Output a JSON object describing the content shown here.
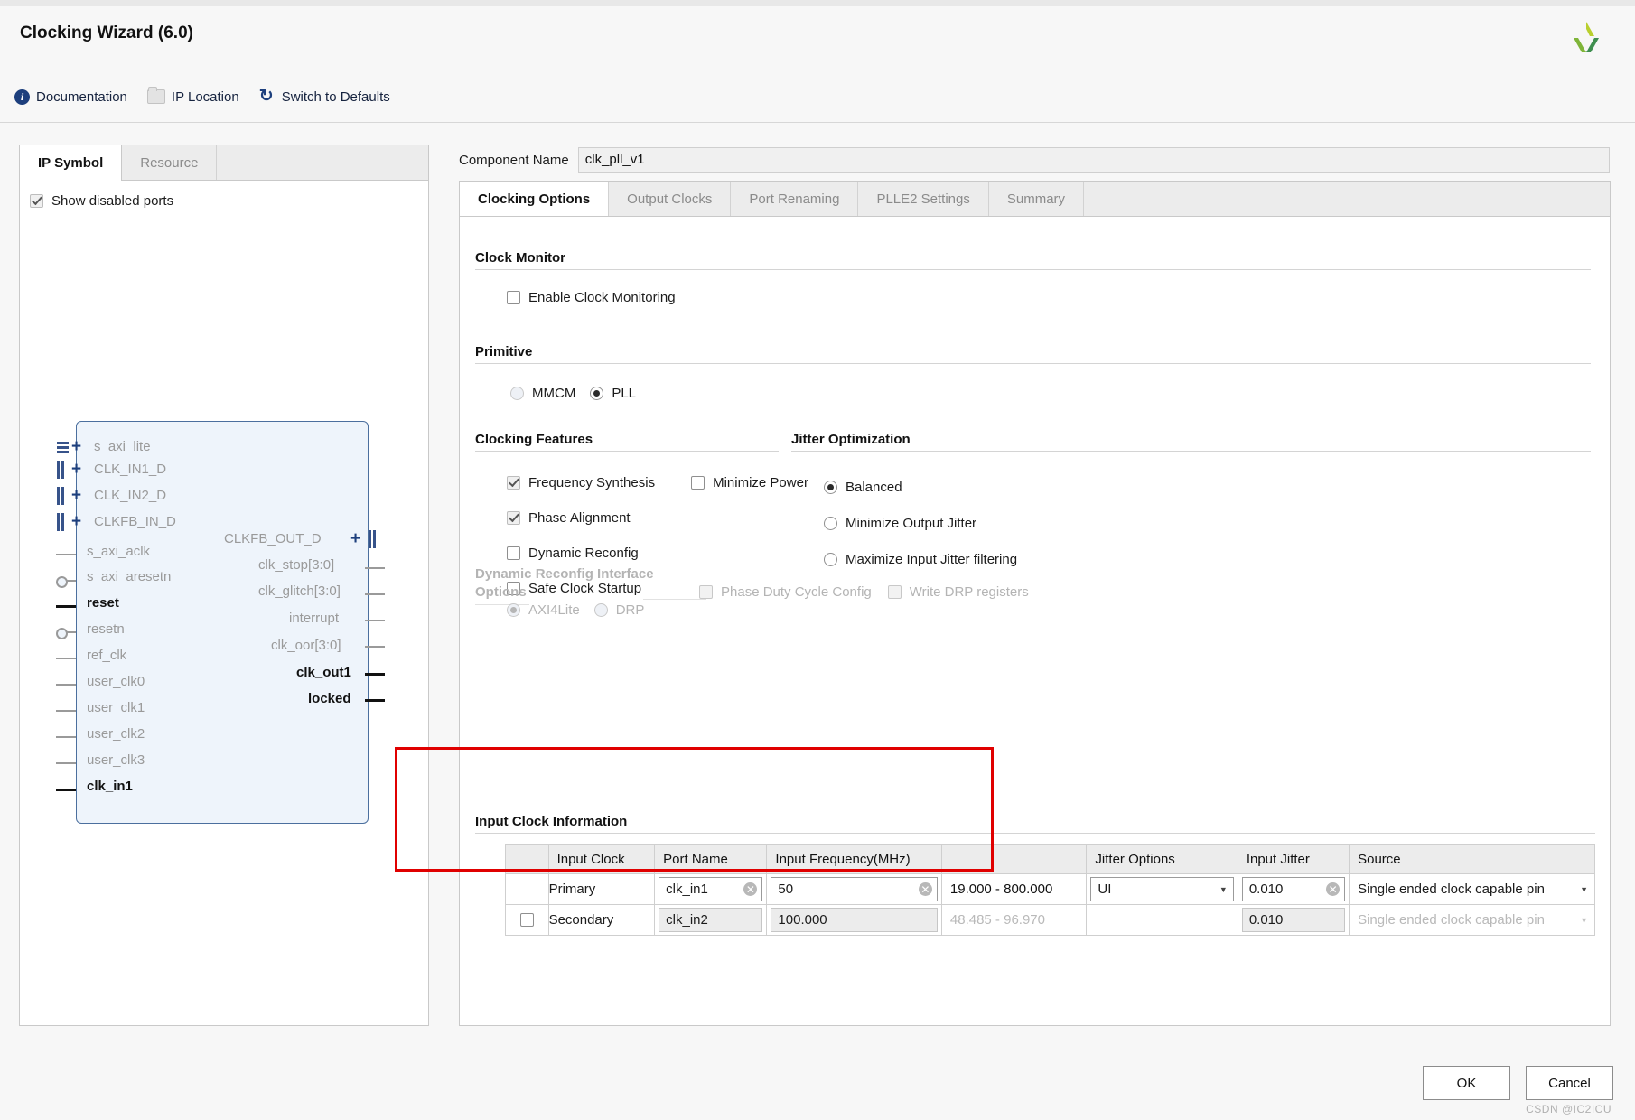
{
  "window": {
    "title": "Clocking Wizard (6.0)"
  },
  "header": {
    "actions": [
      {
        "label": "Documentation",
        "icon": "info-icon"
      },
      {
        "label": "IP Location",
        "icon": "folder-icon"
      },
      {
        "label": "Switch to Defaults",
        "icon": "refresh-icon"
      }
    ]
  },
  "left_panel": {
    "tabs": [
      {
        "label": "IP Symbol",
        "active": true
      },
      {
        "label": "Resource",
        "active": false
      }
    ],
    "show_disabled_ports": {
      "label": "Show disabled ports",
      "checked": true
    },
    "symbol": {
      "inputs_bus": [
        {
          "label": "s_axi_lite",
          "style": "dotted"
        },
        {
          "label": "CLK_IN1_D",
          "style": "bus"
        },
        {
          "label": "CLK_IN2_D",
          "style": "bus"
        },
        {
          "label": "CLKFB_IN_D",
          "style": "bus"
        }
      ],
      "inputs": [
        {
          "label": "s_axi_aclk",
          "style": "plain",
          "bold": false
        },
        {
          "label": "s_axi_aresetn",
          "style": "inverted",
          "bold": false
        },
        {
          "label": "reset",
          "style": "plain",
          "bold": true
        },
        {
          "label": "resetn",
          "style": "inverted",
          "bold": false
        },
        {
          "label": "ref_clk",
          "style": "plain",
          "bold": false
        },
        {
          "label": "user_clk0",
          "style": "plain",
          "bold": false
        },
        {
          "label": "user_clk1",
          "style": "plain",
          "bold": false
        },
        {
          "label": "user_clk2",
          "style": "plain",
          "bold": false
        },
        {
          "label": "user_clk3",
          "style": "plain",
          "bold": false
        },
        {
          "label": "clk_in1",
          "style": "plain",
          "bold": true
        }
      ],
      "outputs": [
        {
          "label": "CLKFB_OUT_D",
          "style": "bus",
          "bold": false
        },
        {
          "label": "clk_stop[3:0]",
          "style": "plain",
          "bold": false
        },
        {
          "label": "clk_glitch[3:0]",
          "style": "plain",
          "bold": false
        },
        {
          "label": "interrupt",
          "style": "plain",
          "bold": false
        },
        {
          "label": "clk_oor[3:0]",
          "style": "plain",
          "bold": false
        },
        {
          "label": "clk_out1",
          "style": "plain",
          "bold": true
        },
        {
          "label": "locked",
          "style": "plain",
          "bold": true
        }
      ]
    }
  },
  "component_name": {
    "label": "Component Name",
    "value": "clk_pll_v1"
  },
  "tabs": [
    {
      "label": "Clocking Options",
      "active": true
    },
    {
      "label": "Output Clocks",
      "active": false
    },
    {
      "label": "Port Renaming",
      "active": false
    },
    {
      "label": "PLLE2 Settings",
      "active": false
    },
    {
      "label": "Summary",
      "active": false
    }
  ],
  "clock_monitor": {
    "title": "Clock Monitor",
    "enable": {
      "label": "Enable Clock Monitoring",
      "checked": false
    }
  },
  "primitive": {
    "title": "Primitive",
    "options": [
      {
        "label": "MMCM",
        "selected": false,
        "disabled": true
      },
      {
        "label": "PLL",
        "selected": true,
        "disabled": false
      }
    ]
  },
  "clocking_features": {
    "title": "Clocking Features",
    "items": [
      {
        "label": "Frequency Synthesis",
        "checked": true
      },
      {
        "label": "Minimize Power",
        "checked": false
      },
      {
        "label": "Phase Alignment",
        "checked": true
      },
      {
        "label": "Dynamic Reconfig",
        "checked": false
      },
      {
        "label": "Safe Clock Startup",
        "checked": false
      }
    ]
  },
  "jitter_optimization": {
    "title": "Jitter Optimization",
    "options": [
      {
        "label": "Balanced",
        "selected": true
      },
      {
        "label": "Minimize Output Jitter",
        "selected": false
      },
      {
        "label": "Maximize Input Jitter filtering",
        "selected": false
      }
    ]
  },
  "dynamic_reconfig": {
    "title": "Dynamic Reconfig Interface Options",
    "options": [
      {
        "label": "AXI4Lite",
        "selected": true
      },
      {
        "label": "DRP",
        "selected": false
      }
    ],
    "checks": [
      {
        "label": "Phase Duty Cycle Config",
        "checked": false
      },
      {
        "label": "Write DRP registers",
        "checked": false
      }
    ]
  },
  "input_clock_information": {
    "title": "Input Clock Information",
    "columns": [
      "",
      "Input Clock",
      "Port Name",
      "Input Frequency(MHz)",
      "",
      "Jitter Options",
      "Input Jitter",
      "Source"
    ],
    "rows": [
      {
        "enabled_checkbox": false,
        "show_checkbox": false,
        "input_clock": "Primary",
        "port_name": "clk_in1",
        "input_frequency": "50",
        "range": "19.000 - 800.000",
        "jitter_options": "UI",
        "input_jitter": "0.010",
        "source": "Single ended clock capable pin",
        "disabled": false
      },
      {
        "enabled_checkbox": false,
        "show_checkbox": true,
        "input_clock": "Secondary",
        "port_name": "clk_in2",
        "input_frequency": "100.000",
        "range": "48.485 - 96.970",
        "jitter_options": "",
        "input_jitter": "0.010",
        "source": "Single ended clock capable pin",
        "disabled": true
      }
    ]
  },
  "footer": {
    "ok": "OK",
    "cancel": "Cancel"
  },
  "watermark": "CSDN @IC2ICU",
  "colors": {
    "accent": "#1d3f7d",
    "highlight": "#e00000",
    "symbol_fill": "#eef4fb"
  }
}
